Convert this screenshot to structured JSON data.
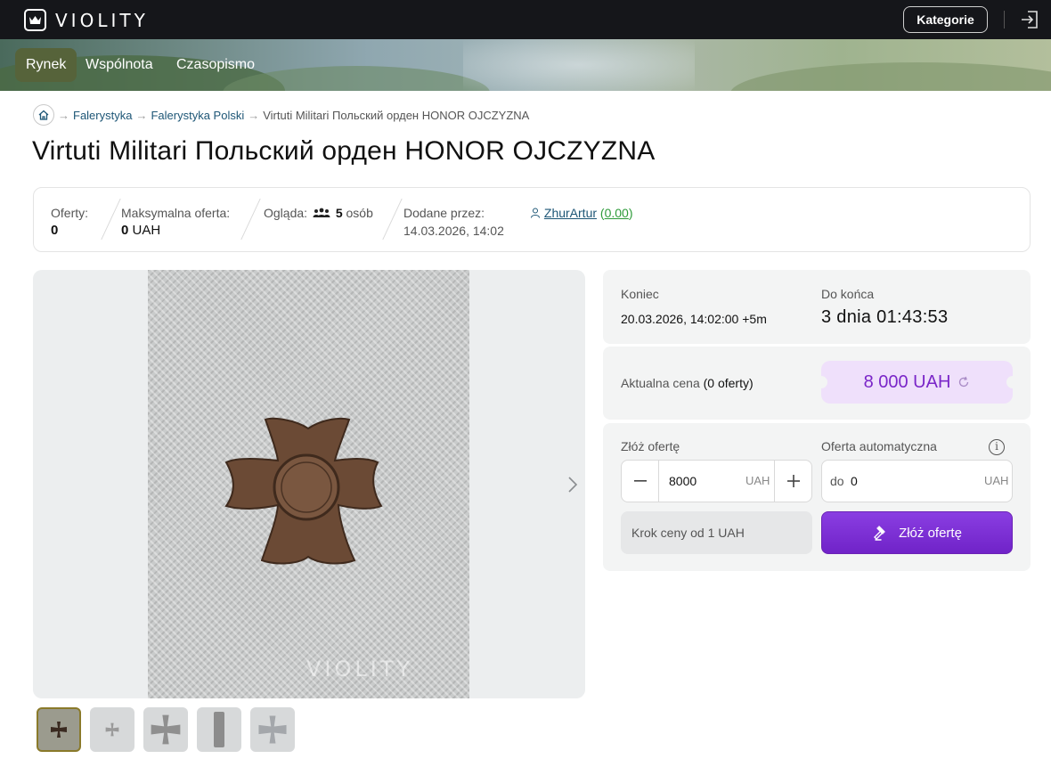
{
  "header": {
    "logo_text": "VIOLITY",
    "kategorie_label": "Kategorie",
    "login_icon": "login-icon"
  },
  "nav": {
    "tabs": [
      {
        "label": "Rynek",
        "active": true
      },
      {
        "label": "Wspólnota",
        "active": false
      },
      {
        "label": "Czasopismo",
        "active": false
      }
    ]
  },
  "breadcrumb": {
    "home_icon": "home-icon",
    "separator": "→",
    "items": [
      "Falerystyka",
      "Falerystyka Polski"
    ],
    "current": "Virtuti Militari Польский орден HONOR OJCZYZNA"
  },
  "lot": {
    "title": "Virtuti Militari Польский орден HONOR OJCZYZNA"
  },
  "stats": {
    "offers_label": "Oferty:",
    "offers_value": "0",
    "max_offer_label": "Maksymalna oferta:",
    "max_offer_amount": "0",
    "max_offer_currency": "UAH",
    "watching_label": "Ogląda:",
    "watching_count": "5",
    "watching_unit": "osób",
    "added_by_label": "Dodane przez:",
    "added_date": "14.03.2026, 14:02",
    "user_name": "ZhurArtur",
    "user_rating_open": "(",
    "user_rating": "0.00",
    "user_rating_close": ")"
  },
  "gallery": {
    "watermark": "VIOLITY",
    "thumbnail_count": 5
  },
  "auction": {
    "end_label": "Koniec",
    "end_datetime": "20.03.2026, 14:02:00 +5m",
    "remaining_label": "Do końca",
    "remaining": "3 dnia 01:43:53",
    "current_price_label": "Aktualna cena",
    "current_price_offers": "(0 oferty)",
    "current_price": "8 000 UAH",
    "bid_label": "Złóż ofertę",
    "bid_value": "8000",
    "bid_currency": "UAH",
    "auto_label": "Oferta automatyczna",
    "auto_prefix": "do",
    "auto_value": "0",
    "auto_currency": "UAH",
    "step_info": "Krok ceny od 1 UAH",
    "submit_label": "Złóż ofertę"
  },
  "colors": {
    "header_bg": "#15161a",
    "active_tab": "#56633a",
    "price_pill": "#efe0fb",
    "price_text": "#7a26c8",
    "submit": "#7a2fd6",
    "link": "#1d5676",
    "rating": "#2e9b3a"
  }
}
